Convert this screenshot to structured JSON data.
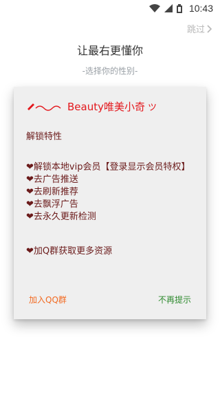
{
  "status": {
    "time": "10:43"
  },
  "header": {
    "skip_label": "跳过",
    "title": "让最右更懂你",
    "subtitle": "-选择你的性别-"
  },
  "dialog": {
    "title": "Beauty唯美小奇",
    "heading": "解锁特性",
    "features": [
      "❤解锁本地vip会员【登录显示会员特权】",
      "❤去广告推送",
      "❤去刷新推荐",
      "❤去飘浮广告",
      "❤去永久更新检测"
    ],
    "qq_group_text": "❤加Q群获取更多资源",
    "join_qq_label": "加入QQ群",
    "no_more_label": "不再提示"
  },
  "icons": {
    "wifi": "wifi-icon",
    "signal": "cell-signal-icon",
    "battery": "battery-icon",
    "skip": "chevron-right-icon",
    "pen": "pen-icon"
  },
  "colors": {
    "accent_red": "#e3171c",
    "text_dark_red": "#6b1b1b",
    "orange": "#f26a21",
    "green": "#2f8b2f"
  }
}
